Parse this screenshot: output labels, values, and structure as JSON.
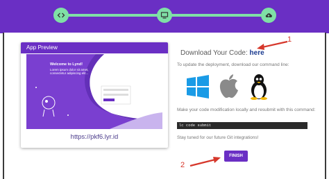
{
  "header": {
    "accent_color": "#6a2fc4",
    "stepper": {
      "color": "#7fe0a6",
      "steps": [
        {
          "icon": "code-icon",
          "state": "complete"
        },
        {
          "icon": "desktop-icon",
          "state": "complete"
        },
        {
          "icon": "cloud-upload-icon",
          "state": "current"
        }
      ]
    }
  },
  "preview": {
    "title": "App Preview",
    "screenshot": {
      "welcome": "Welcome to Lynd!",
      "body": "Lorem ipsum dolor sit amet, consectetur adipiscing elit..."
    },
    "url": "https://pkf6.lyr.id"
  },
  "download": {
    "label": "Download Your Code:",
    "link_text": "here"
  },
  "deploy_text": "To update the deployment, download our command line:",
  "os_icons": [
    "windows-icon",
    "apple-icon",
    "linux-icon"
  ],
  "modify_text": "Make your code modification locally and resubmit with this command:",
  "command": "lc code submit",
  "git_text": "Stay tuned for our future Git integrations!",
  "finish_label": "FINISH",
  "annotations": {
    "one": "1",
    "two": "2",
    "color": "#d6372b"
  }
}
